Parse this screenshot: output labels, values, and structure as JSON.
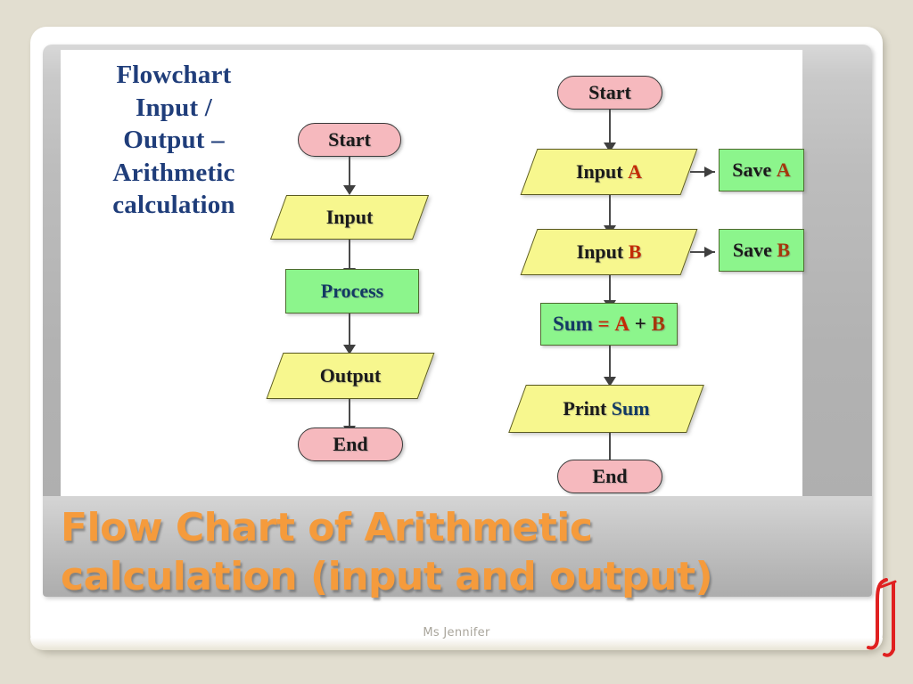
{
  "slide": {
    "title": "Flow Chart of Arithmetic\ncalculation (input and output)",
    "footer": "Ms Jennifer",
    "accent_color": "#f59b3c",
    "background_color": "#e2ded0"
  },
  "image": {
    "heading": "Flowchart\nInput /\nOutput –\nArithmetic\ncalculation",
    "heading_color": "#1f3d7a",
    "palette": {
      "terminal_fill": "#f6b9be",
      "io_fill": "#f7f78e",
      "process_fill": "#8cf58c",
      "line": "#4a4a4a",
      "emphasis_red": "#c32b06",
      "label_navy": "#123a63"
    },
    "left_flowchart": {
      "nodes": [
        {
          "label": "Start",
          "shape": "terminal"
        },
        {
          "label": "Input",
          "shape": "parallelogram"
        },
        {
          "label": "Process",
          "shape": "rectangle"
        },
        {
          "label": "Output",
          "shape": "parallelogram"
        },
        {
          "label": "End",
          "shape": "terminal"
        }
      ]
    },
    "right_flowchart": {
      "nodes": [
        {
          "label": "Start",
          "shape": "terminal"
        },
        {
          "label": "Input A",
          "shape": "parallelogram"
        },
        {
          "label": "Input B",
          "shape": "parallelogram"
        },
        {
          "label": "Sum = A + B",
          "shape": "rectangle"
        },
        {
          "label": "Print Sum",
          "shape": "parallelogram"
        },
        {
          "label": "End",
          "shape": "terminal"
        }
      ],
      "side_nodes": [
        {
          "label": "Save A",
          "shape": "rectangle"
        },
        {
          "label": "Save B",
          "shape": "rectangle"
        }
      ],
      "tokens": {
        "input_word": "Input",
        "a": "A",
        "b": "B",
        "save_word": "Save",
        "sum_word": "Sum",
        "equals": "=",
        "plus": "+",
        "print_word": "Print",
        "print_sum_tail": "Sum"
      }
    }
  },
  "annotation": {
    "mark": "red-pen-stroke",
    "color": "#e02020"
  }
}
